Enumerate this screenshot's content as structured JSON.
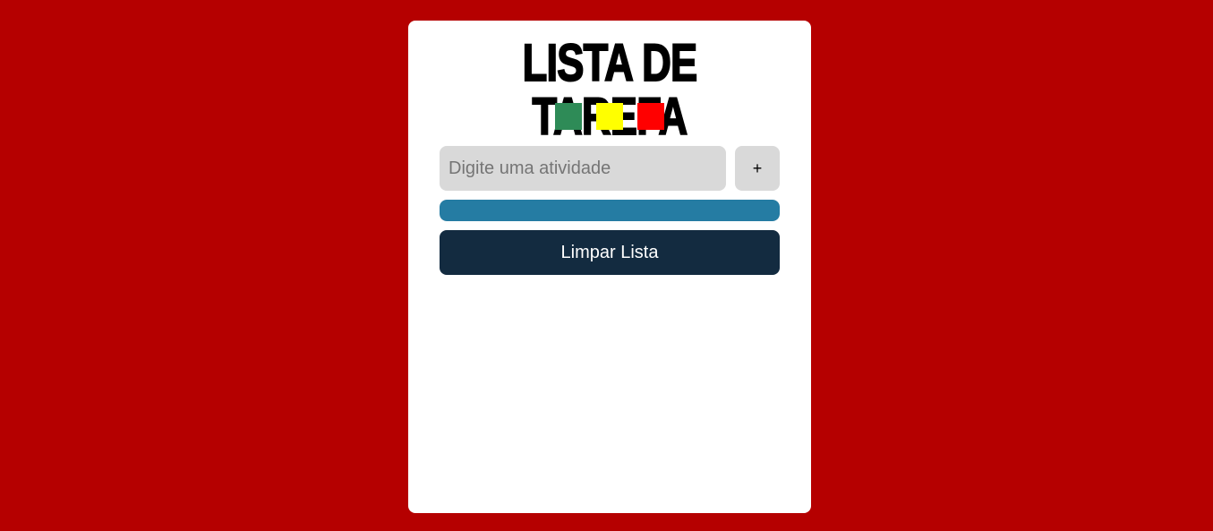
{
  "app": {
    "title": "LISTA DE TAREFA",
    "background_color": "#b50000"
  },
  "color_options": [
    {
      "name": "green",
      "color": "#2e8b57"
    },
    {
      "name": "yellow",
      "color": "#ffff00"
    },
    {
      "name": "red",
      "color": "#ff0000"
    }
  ],
  "task_input": {
    "value": "",
    "placeholder": "Digite uma atividade"
  },
  "add_button": {
    "label": "+"
  },
  "progress": {
    "fraction": 1.0,
    "color": "#257ca3"
  },
  "clear_button": {
    "label": "Limpar Lista",
    "color": "#132b40"
  },
  "tasks": []
}
